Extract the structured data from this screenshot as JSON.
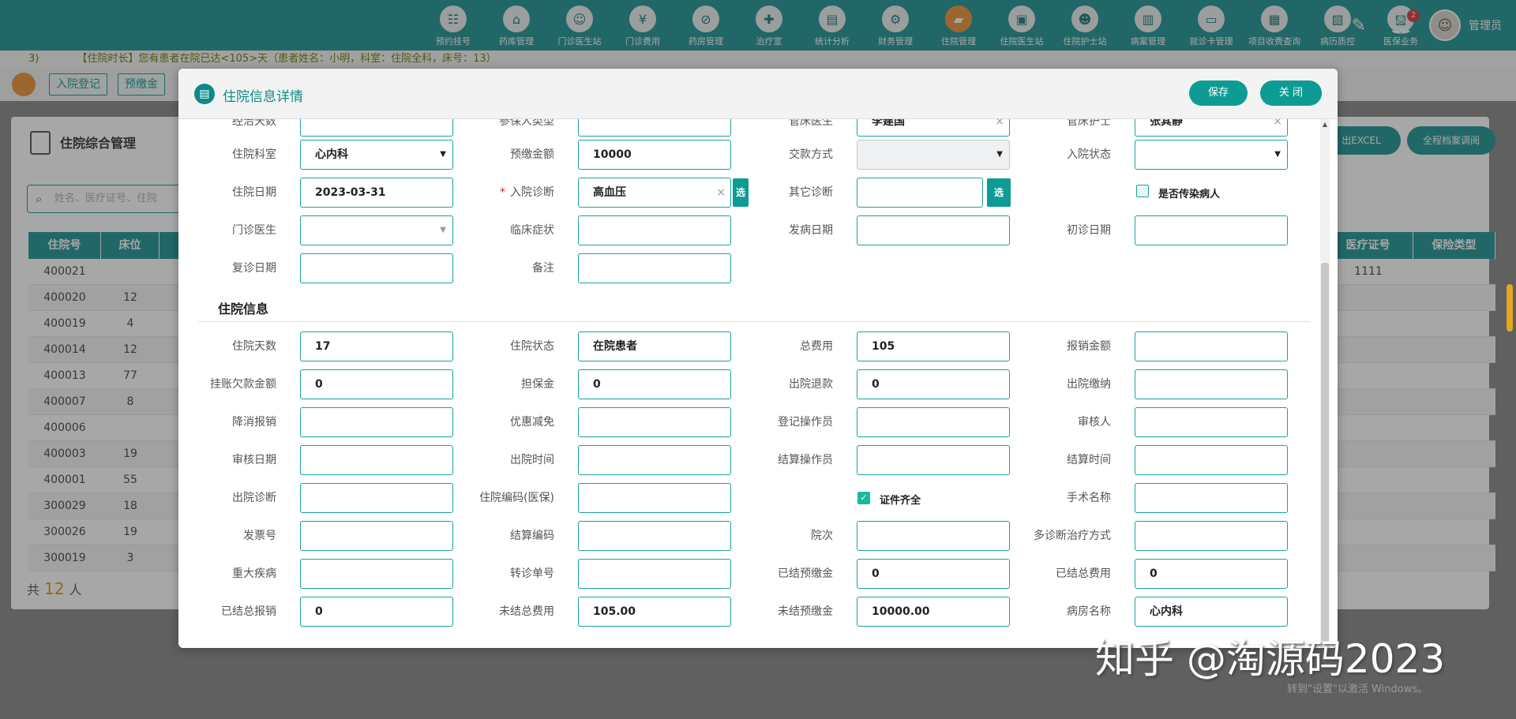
{
  "nav": [
    {
      "label": "预约挂号",
      "icon": "calendar-icon",
      "glyph": "☷"
    },
    {
      "label": "药库管理",
      "icon": "warehouse-icon",
      "glyph": "⌂"
    },
    {
      "label": "门诊医生站",
      "icon": "doctor-icon",
      "glyph": "☺"
    },
    {
      "label": "门诊费用",
      "icon": "yen-icon",
      "glyph": "¥"
    },
    {
      "label": "药房管理",
      "icon": "pill-icon",
      "glyph": "⊘"
    },
    {
      "label": "治疗室",
      "icon": "treatment-icon",
      "glyph": "✚"
    },
    {
      "label": "统计分析",
      "icon": "chart-icon",
      "glyph": "▤"
    },
    {
      "label": "财务管理",
      "icon": "gear-icon",
      "glyph": "⚙"
    },
    {
      "label": "住院管理",
      "icon": "bed-icon",
      "glyph": "▰"
    },
    {
      "label": "住院医生站",
      "icon": "doctor-card-icon",
      "glyph": "▣"
    },
    {
      "label": "住院护士站",
      "icon": "nurse-icon",
      "glyph": "☻"
    },
    {
      "label": "病案管理",
      "icon": "record-icon",
      "glyph": "▥"
    },
    {
      "label": "就诊卡管理",
      "icon": "card-icon",
      "glyph": "▭"
    },
    {
      "label": "项目收费查询",
      "icon": "bill-icon",
      "glyph": "▦"
    },
    {
      "label": "病历质控",
      "icon": "quality-icon",
      "glyph": "▧"
    },
    {
      "label": "医保业务",
      "icon": "insurance-icon",
      "glyph": "▨"
    }
  ],
  "user": {
    "name": "管理员",
    "notifications": "2"
  },
  "notice": {
    "count": "3)",
    "text": "【住院时长】您有患者在院已达<105>天（患者姓名：小明，科室：住院全科，床号：13）"
  },
  "tabs": [
    "入院登记",
    "预缴金"
  ],
  "panel": {
    "title": "住院综合管理",
    "search_placeholder": "姓名、医疗证号、住院",
    "excel_label": "出EXCEL",
    "archive_label": "全程档案调阅",
    "headers": [
      "住院号",
      "床位",
      "医疗证号",
      "保险类型"
    ],
    "rows": [
      {
        "id": "400021",
        "bed": "",
        "med": "1111"
      },
      {
        "id": "400020",
        "bed": "12",
        "med": ""
      },
      {
        "id": "400019",
        "bed": "4",
        "med": ""
      },
      {
        "id": "400014",
        "bed": "12",
        "med": ""
      },
      {
        "id": "400013",
        "bed": "77",
        "med": ""
      },
      {
        "id": "400007",
        "bed": "8",
        "med": ""
      },
      {
        "id": "400006",
        "bed": "",
        "med": ""
      },
      {
        "id": "400003",
        "bed": "19",
        "med": ""
      },
      {
        "id": "400001",
        "bed": "55",
        "med": ""
      },
      {
        "id": "300029",
        "bed": "18",
        "med": ""
      },
      {
        "id": "300026",
        "bed": "19",
        "med": ""
      },
      {
        "id": "300019",
        "bed": "3",
        "med": ""
      }
    ],
    "count_prefix": "共",
    "count": "12",
    "count_suffix": "人"
  },
  "dialog": {
    "title": "住院信息详情",
    "save": "保存",
    "close": "关 闭",
    "section": "住院信息",
    "pick": "选",
    "top_partial": {
      "fields": [
        {
          "label": "经治天数",
          "value": ""
        },
        {
          "label": "参保人类型",
          "value": ""
        },
        {
          "label": "管床医生",
          "value": "李建国"
        },
        {
          "label": "管床护士",
          "value": "张其静"
        }
      ]
    },
    "basic": {
      "dept_label": "住院科室",
      "dept_value": "心内科",
      "deposit_label": "预缴金额",
      "deposit_value": "10000",
      "pay_label": "交款方式",
      "pay_value": "",
      "admit_status_label": "入院状态",
      "admit_status_value": "",
      "date_label": "住院日期",
      "date_value": "2023-03-31",
      "diag_label": "入院诊断",
      "diag_value": "高血压",
      "other_diag_label": "其它诊断",
      "other_diag_value": "",
      "infect_label": "是否传染病人",
      "infect_checked": false,
      "opd_doctor_label": "门诊医生",
      "opd_doctor_value": "",
      "symptom_label": "临床症状",
      "symptom_value": "",
      "onset_label": "发病日期",
      "onset_value": "",
      "first_visit_label": "初诊日期",
      "first_visit_value": "",
      "revisit_label": "复诊日期",
      "revisit_value": "",
      "remark_label": "备注",
      "remark_value": ""
    },
    "grid": [
      [
        {
          "label": "住院天数",
          "value": "17"
        },
        {
          "label": "住院状态",
          "value": "在院患者"
        },
        {
          "label": "总费用",
          "value": "105"
        },
        {
          "label": "报销金额",
          "value": ""
        }
      ],
      [
        {
          "label": "挂账欠款金额",
          "value": "0"
        },
        {
          "label": "担保金",
          "value": "0"
        },
        {
          "label": "出院退款",
          "value": "0"
        },
        {
          "label": "出院缴纳",
          "value": ""
        }
      ],
      [
        {
          "label": "降消报销",
          "value": ""
        },
        {
          "label": "优惠减免",
          "value": ""
        },
        {
          "label": "登记操作员",
          "value": ""
        },
        {
          "label": "审核人",
          "value": ""
        }
      ],
      [
        {
          "label": "审核日期",
          "value": ""
        },
        {
          "label": "出院时间",
          "value": ""
        },
        {
          "label": "结算操作员",
          "value": ""
        },
        {
          "label": "结算时间",
          "value": ""
        }
      ],
      [
        {
          "label": "出院诊断",
          "value": ""
        },
        {
          "label": "住院编码(医保)",
          "value": ""
        },
        {
          "label": "",
          "value": ""
        },
        {
          "label": "手术名称",
          "value": ""
        }
      ],
      [
        {
          "label": "发票号",
          "value": ""
        },
        {
          "label": "结算编码",
          "value": ""
        },
        {
          "label": "院次",
          "value": ""
        },
        {
          "label": "多诊断治疗方式",
          "value": ""
        }
      ],
      [
        {
          "label": "重大疾病",
          "value": ""
        },
        {
          "label": "转诊单号",
          "value": ""
        },
        {
          "label": "已结预缴金",
          "value": "0"
        },
        {
          "label": "已结总费用",
          "value": "0"
        }
      ],
      [
        {
          "label": "已结总报销",
          "value": "0"
        },
        {
          "label": "未结总费用",
          "value": "105.00"
        },
        {
          "label": "未结预缴金",
          "value": "10000.00"
        },
        {
          "label": "病房名称",
          "value": "心内科"
        }
      ]
    ],
    "cert_label": "证件齐全",
    "cert_checked": true
  },
  "watermark": {
    "text": "知乎 @淘源码2023",
    "note": "转到\"设置\"以激活 Windows。"
  }
}
